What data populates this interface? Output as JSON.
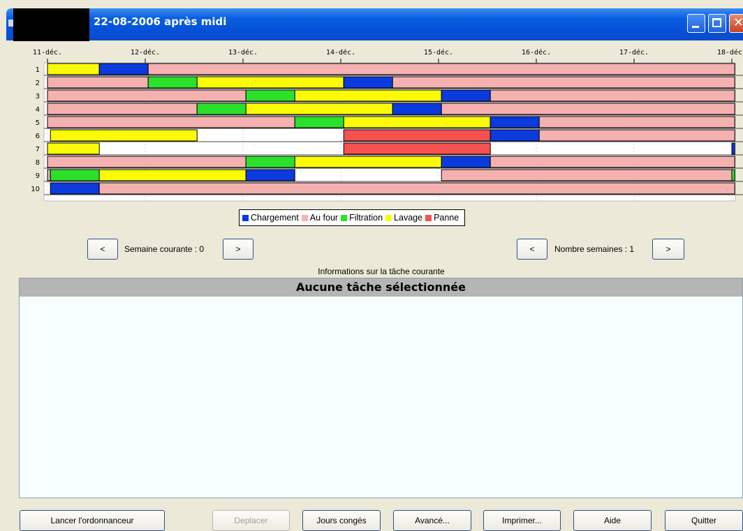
{
  "window": {
    "title": "22-08-2006 après midi",
    "controls": [
      "minimize",
      "maximize",
      "close"
    ]
  },
  "gantt": {
    "day_labels": [
      "11-déc.",
      "12-déc.",
      "13-déc.",
      "14-déc.",
      "15-déc.",
      "16-déc.",
      "17-déc.",
      "18-déc."
    ],
    "colors": {
      "Chargement": "#0b3bdf",
      "Au four": "#f5b0b0",
      "Filtration": "#2be02b",
      "Lavage": "#fbfb07",
      "Panne": "#f6504f"
    },
    "rows": [
      {
        "label": "1",
        "segments": [
          {
            "task": "Lavage",
            "start": 0,
            "end": 0.53
          },
          {
            "task": "Chargement",
            "start": 0.53,
            "end": 1.03
          },
          {
            "task": "Au four",
            "start": 1.03,
            "end": 7.03
          }
        ]
      },
      {
        "label": "2",
        "segments": [
          {
            "task": "Au four",
            "start": 0,
            "end": 1.03
          },
          {
            "task": "Filtration",
            "start": 1.03,
            "end": 1.53
          },
          {
            "task": "Lavage",
            "start": 1.53,
            "end": 3.03
          },
          {
            "task": "Chargement",
            "start": 3.03,
            "end": 3.53
          },
          {
            "task": "Au four",
            "start": 3.53,
            "end": 7.03
          }
        ]
      },
      {
        "label": "3",
        "segments": [
          {
            "task": "Au four",
            "start": 0,
            "end": 2.03
          },
          {
            "task": "Filtration",
            "start": 2.03,
            "end": 2.53
          },
          {
            "task": "Lavage",
            "start": 2.53,
            "end": 4.03
          },
          {
            "task": "Chargement",
            "start": 4.03,
            "end": 4.53
          },
          {
            "task": "Au four",
            "start": 4.53,
            "end": 7.03
          }
        ]
      },
      {
        "label": "4",
        "segments": [
          {
            "task": "Au four",
            "start": 0,
            "end": 1.53
          },
          {
            "task": "Filtration",
            "start": 1.53,
            "end": 2.03
          },
          {
            "task": "Lavage",
            "start": 2.03,
            "end": 3.53
          },
          {
            "task": "Chargement",
            "start": 3.53,
            "end": 4.03
          },
          {
            "task": "Au four",
            "start": 4.03,
            "end": 7.03
          }
        ]
      },
      {
        "label": "5",
        "segments": [
          {
            "task": "Au four",
            "start": 0,
            "end": 2.53
          },
          {
            "task": "Filtration",
            "start": 2.53,
            "end": 3.03
          },
          {
            "task": "Lavage",
            "start": 3.03,
            "end": 4.53
          },
          {
            "task": "Chargement",
            "start": 4.53,
            "end": 5.03
          },
          {
            "task": "Au four",
            "start": 5.03,
            "end": 7.03
          }
        ]
      },
      {
        "label": "6",
        "segments": [
          {
            "task": "Lavage",
            "start": 0.03,
            "end": 1.53
          },
          {
            "task": "Panne",
            "start": 3.03,
            "end": 4.53
          },
          {
            "task": "Chargement",
            "start": 4.53,
            "end": 5.03
          },
          {
            "task": "Au four",
            "start": 5.03,
            "end": 7.03
          }
        ]
      },
      {
        "label": "7",
        "segments": [
          {
            "task": "Lavage",
            "start": 0,
            "end": 0.53
          },
          {
            "task": "Panne",
            "start": 3.03,
            "end": 4.53
          },
          {
            "task": "Chargement",
            "start": 7.0,
            "end": 7.03
          }
        ]
      },
      {
        "label": "8",
        "segments": [
          {
            "task": "Au four",
            "start": 0,
            "end": 2.03
          },
          {
            "task": "Filtration",
            "start": 2.03,
            "end": 2.53
          },
          {
            "task": "Lavage",
            "start": 2.53,
            "end": 4.03
          },
          {
            "task": "Chargement",
            "start": 4.03,
            "end": 4.53
          },
          {
            "task": "Au four",
            "start": 4.53,
            "end": 7.03
          }
        ]
      },
      {
        "label": "9",
        "segments": [
          {
            "task": "Au four",
            "start": 0,
            "end": 0.03
          },
          {
            "task": "Filtration",
            "start": 0.03,
            "end": 0.53
          },
          {
            "task": "Lavage",
            "start": 0.53,
            "end": 2.03
          },
          {
            "task": "Chargement",
            "start": 2.03,
            "end": 2.53
          },
          {
            "task": "Au four",
            "start": 4.03,
            "end": 7.0
          },
          {
            "task": "Filtration",
            "start": 7.0,
            "end": 7.03
          }
        ]
      },
      {
        "label": "10",
        "segments": [
          {
            "task": "Chargement",
            "start": 0.03,
            "end": 0.53
          },
          {
            "task": "Au four",
            "start": 0.53,
            "end": 7.03
          }
        ]
      }
    ]
  },
  "legend": {
    "items": [
      {
        "label": "Chargement",
        "color": "#0b3bdf"
      },
      {
        "label": "Au four",
        "color": "#f5b0b0"
      },
      {
        "label": "Filtration",
        "color": "#2be02b"
      },
      {
        "label": "Lavage",
        "color": "#fbfb07"
      },
      {
        "label": "Panne",
        "color": "#f6504f"
      }
    ]
  },
  "week_nav": {
    "prev": "<",
    "label": "Semaine courante : 0",
    "next": ">"
  },
  "count_nav": {
    "prev": "<",
    "label": "Nombre semaines : 1",
    "next": ">"
  },
  "info": {
    "caption": "Informations sur la tâche courante",
    "header": "Aucune tâche sélectionnée"
  },
  "buttons": {
    "schedule": "Lancer l'ordonnanceur",
    "move": "Deplacer",
    "holidays": "Jours congés",
    "advanced": "Avancé...",
    "print": "Imprimer...",
    "help": "Aide",
    "quit": "Quitter"
  }
}
